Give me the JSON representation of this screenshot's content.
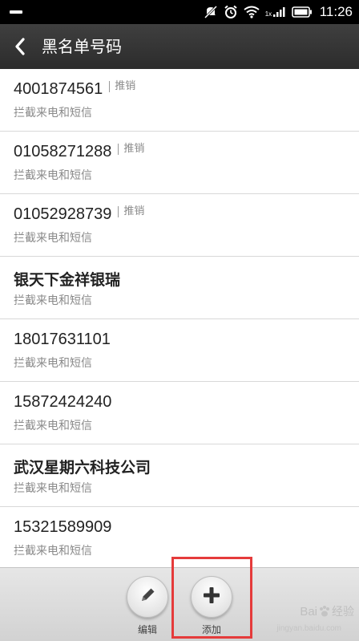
{
  "status_bar": {
    "time": "11:26",
    "network_label": "1x",
    "icons": [
      "mute-icon",
      "alarm-icon",
      "wifi-icon",
      "signal-icon",
      "battery-icon"
    ]
  },
  "header": {
    "title": "黑名单号码",
    "back_icon": "chevron-left-icon"
  },
  "list": {
    "items": [
      {
        "number": "4001874561",
        "tag": "推销",
        "subtitle": "拦截来电和短信"
      },
      {
        "number": "01058271288",
        "tag": "推销",
        "subtitle": "拦截来电和短信"
      },
      {
        "number": "01052928739",
        "tag": "推销",
        "subtitle": "拦截来电和短信"
      },
      {
        "name": "银天下金祥银瑞",
        "subtitle": "拦截来电和短信"
      },
      {
        "number": "18017631101",
        "subtitle": "拦截来电和短信"
      },
      {
        "number": "15872424240",
        "subtitle": "拦截来电和短信"
      },
      {
        "name": "武汉星期六科技公司",
        "subtitle": "拦截来电和短信"
      },
      {
        "number": "15321589909",
        "subtitle": "拦截来电和短信"
      }
    ]
  },
  "toolbar": {
    "edit_label": "编辑",
    "add_label": "添加"
  },
  "watermark": {
    "text": "Bai",
    "text2": "经验",
    "url": "jingyan.baidu.com"
  },
  "colors": {
    "header_bg": "#333333",
    "highlight": "#e53b3b",
    "subtitle": "#8a8a8a"
  }
}
